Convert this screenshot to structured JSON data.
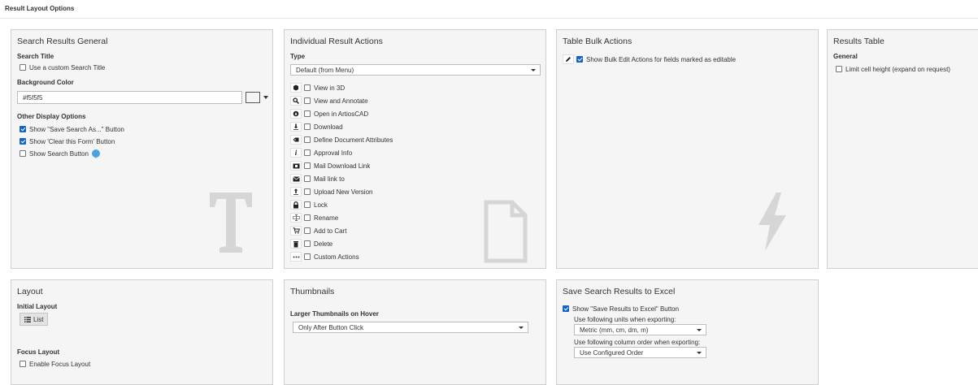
{
  "page": {
    "title": "Result Layout Options"
  },
  "search_general": {
    "title": "Search Results General",
    "search_title_label": "Search Title",
    "custom_title_option": "Use a custom Search Title",
    "custom_title_checked": false,
    "bg_color_label": "Background Color",
    "bg_color_value": "#f5f5f5",
    "other_options_label": "Other Display Options",
    "options": [
      {
        "label": "Show \"Save Search As...\" Button",
        "checked": true
      },
      {
        "label": "Show 'Clear this Form' Button",
        "checked": true
      },
      {
        "label": "Show Search Button",
        "checked": false
      }
    ]
  },
  "individual_actions": {
    "title": "Individual Result Actions",
    "type_label": "Type",
    "type_value": "Default (from Menu)",
    "actions": [
      {
        "label": "View in 3D",
        "icon": "cube-icon",
        "checked": false
      },
      {
        "label": "View and Annotate",
        "icon": "magnifier-icon",
        "checked": false
      },
      {
        "label": "Open in ArtiosCAD",
        "icon": "artioscad-icon",
        "checked": false
      },
      {
        "label": "Download",
        "icon": "download-icon",
        "checked": false
      },
      {
        "label": "Define Document Attributes",
        "icon": "attributes-icon",
        "checked": false
      },
      {
        "label": "Approval Info",
        "icon": "info-icon",
        "checked": false
      },
      {
        "label": "Mail Download Link",
        "icon": "mail-download-icon",
        "checked": false
      },
      {
        "label": "Mail link to",
        "icon": "envelope-icon",
        "checked": false
      },
      {
        "label": "Upload New Version",
        "icon": "upload-icon",
        "checked": false
      },
      {
        "label": "Lock",
        "icon": "lock-icon",
        "checked": false
      },
      {
        "label": "Rename",
        "icon": "rename-icon",
        "checked": false
      },
      {
        "label": "Add to Cart",
        "icon": "cart-icon",
        "checked": false
      },
      {
        "label": "Delete",
        "icon": "trash-icon",
        "checked": false
      },
      {
        "label": "Custom Actions",
        "icon": "ellipsis-icon",
        "checked": false
      }
    ]
  },
  "bulk_actions": {
    "title": "Table Bulk Actions",
    "option": {
      "label": "Show Bulk Edit Actions for fields marked as editable",
      "checked": true,
      "icon": "pencil-icon"
    }
  },
  "results_table": {
    "title": "Results Table",
    "general_label": "General",
    "option": {
      "label": "Limit cell height (expand on request)",
      "checked": false
    }
  },
  "layout": {
    "title": "Layout",
    "initial_label": "Initial Layout",
    "list_button": "List",
    "focus_label": "Focus Layout",
    "focus_option": {
      "label": "Enable Focus Layout",
      "checked": false
    }
  },
  "thumbnails": {
    "title": "Thumbnails",
    "hover_label": "Larger Thumbnails on Hover",
    "hover_value": "Only After Button Click"
  },
  "excel": {
    "title": "Save Search Results to Excel",
    "show_option": {
      "label": "Show \"Save Results to Excel\" Button",
      "checked": true
    },
    "units_label": "Use following units when exporting:",
    "units_value": "Metric (mm, cm, dm, m)",
    "order_label": "Use following column order when exporting:",
    "order_value": "Use Configured Order"
  },
  "colors": {
    "panel_bg": "#f5f5f5",
    "checkbox_on": "#1565c0",
    "watermark": "#d6d6d6",
    "info_accent": "#4aa3df"
  }
}
